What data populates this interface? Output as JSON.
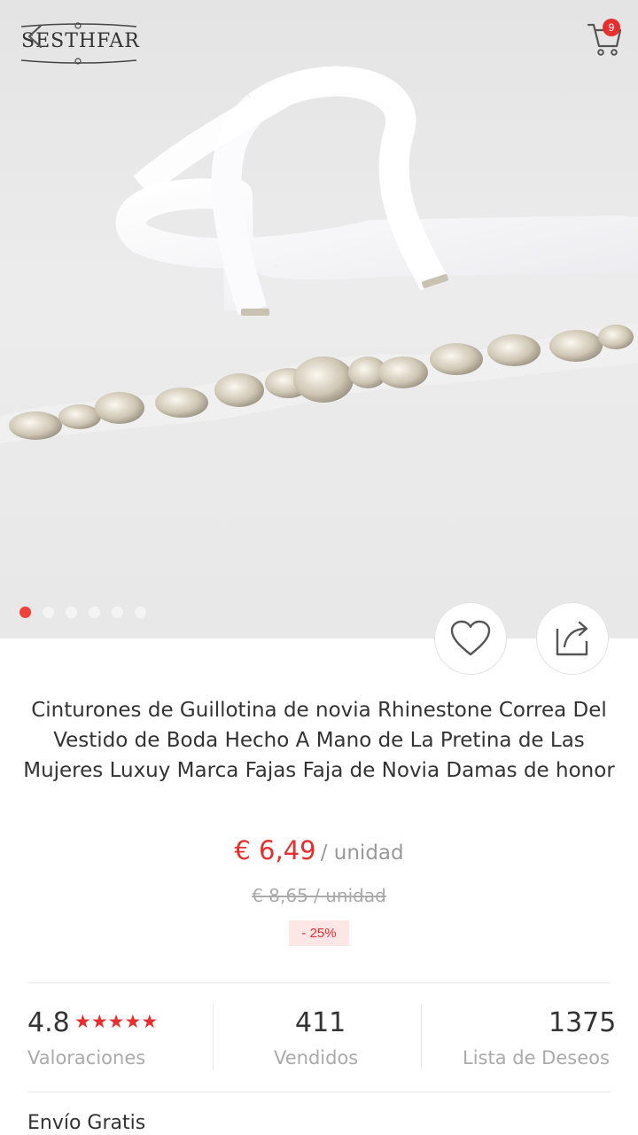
{
  "header": {
    "brand": "SESTHFAR",
    "cart_count": "9"
  },
  "gallery": {
    "image_count": 6,
    "active_index": 0
  },
  "product": {
    "title": "Cinturones de Guillotina de novia Rhinestone Correa Del Vestido de Boda Hecho A Mano de La Pretina de Las Mujeres Luxuy Marca Fajas Faja de Novia Damas de honor",
    "price": "€ 6,49",
    "price_unit": "/ unidad",
    "old_price": "€ 8,65 / unidad",
    "discount": "- 25%"
  },
  "stats": {
    "rating": "4.8",
    "rating_stars": 5,
    "rating_label": "Valoraciones",
    "sold": "411",
    "sold_label": "Vendidos",
    "wishlist": "1375",
    "wishlist_label": "Lista de Deseos"
  },
  "shipping": {
    "label": "Envío Gratis"
  },
  "colors": {
    "accent": "#e62e2e",
    "muted_text": "#999999"
  }
}
